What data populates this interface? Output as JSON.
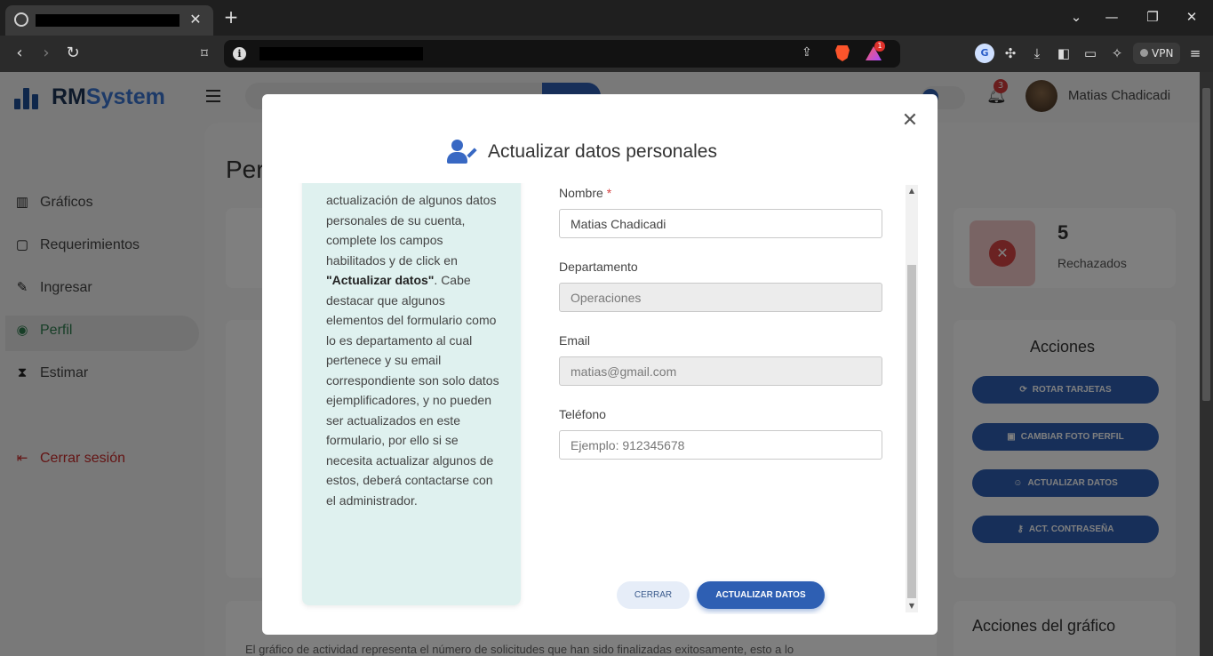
{
  "browser": {
    "tab_close": "✕",
    "new_tab": "+",
    "window_controls": [
      "⌄",
      "—",
      "❐",
      "✕"
    ],
    "rewards_badge": "1",
    "vpn_label": "VPN"
  },
  "app": {
    "brand_prefix": "RM",
    "brand_suffix": "System",
    "notifications_count": "3",
    "user_name": "Matias Chadicadi",
    "page_title": "Per",
    "sidebar": [
      {
        "label": "Gráficos",
        "icon": "bar-chart-icon"
      },
      {
        "label": "Requerimientos",
        "icon": "clipboard-icon"
      },
      {
        "label": "Ingresar",
        "icon": "pen-icon"
      },
      {
        "label": "Perfil",
        "icon": "user-circle-icon"
      },
      {
        "label": "Estimar",
        "icon": "hourglass-icon"
      }
    ],
    "logout_label": "Cerrar sesión",
    "stats": {
      "rejected_count": "5",
      "rejected_label": "Rechazados"
    },
    "actions_title": "Acciones",
    "actions": [
      {
        "label": "ROTAR TARJETAS",
        "icon": "rotate-icon"
      },
      {
        "label": "CAMBIAR FOTO PERFIL",
        "icon": "camera-icon"
      },
      {
        "label": "ACTUALIZAR DATOS",
        "icon": "user-edit-icon"
      },
      {
        "label": "ACT. CONTRASEÑA",
        "icon": "key-icon"
      }
    ],
    "graph_actions_title": "Acciones del gráfico",
    "graph_description": "El gráfico de actividad representa el número de solicitudes que han sido finalizadas exitosamente, esto a lo"
  },
  "modal": {
    "title": "Actualizar datos personales",
    "info_text_part1": "actualización de algunos datos personales de su cuenta, complete los campos habilitados y de click en ",
    "info_text_bold": "\"Actualizar datos\"",
    "info_text_part2": ". Cabe destacar que algunos elementos del formulario como lo es departamento al cual pertenece y su email correspondiente son solo datos ejemplificadores, y no pueden ser actualizados en este formulario, por ello si se necesita actualizar algunos de estos, deberá contactarse con el administrador.",
    "fields": {
      "nombre_label": "Nombre",
      "nombre_required": "*",
      "nombre_value": "Matias Chadicadi",
      "departamento_label": "Departamento",
      "departamento_value": "Operaciones",
      "email_label": "Email",
      "email_value": "matias@gmail.com",
      "telefono_label": "Teléfono",
      "telefono_placeholder": "Ejemplo: 912345678"
    },
    "close_button": "CERRAR",
    "submit_button": "ACTUALIZAR DATOS"
  }
}
